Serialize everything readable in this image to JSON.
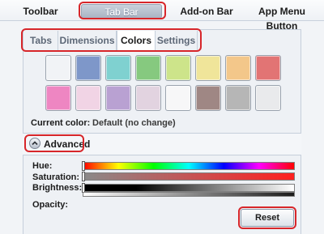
{
  "top_tabs": [
    {
      "label": "Toolbar"
    },
    {
      "label": "Tab Bar",
      "selected": true
    },
    {
      "label": "Add-on Bar"
    },
    {
      "label": "App Menu Button"
    }
  ],
  "sub_tabs": [
    {
      "label": "Tabs"
    },
    {
      "label": "Dimensions"
    },
    {
      "label": "Colors",
      "selected": true
    },
    {
      "label": "Settings"
    }
  ],
  "swatches": [
    {
      "color": "#f1f3f6"
    },
    {
      "color": "#7e97c9"
    },
    {
      "color": "#7fd1d0"
    },
    {
      "color": "#86c97f"
    },
    {
      "color": "#cde48a"
    },
    {
      "color": "#f0e59a"
    },
    {
      "color": "#f3c78a"
    },
    {
      "color": "#e27474"
    },
    {
      "color": "#ee86c2"
    },
    {
      "color": "#f1d4e5"
    },
    {
      "color": "#b9a1d2"
    },
    {
      "color": "#e2d3e0"
    },
    {
      "color": "#f7f7f8"
    },
    {
      "color": "#9f8784"
    },
    {
      "color": "#b6b6b6"
    },
    {
      "color": "#e9eaec"
    }
  ],
  "current_color": {
    "label": "Current color:",
    "value": "Default (no change)"
  },
  "advanced": {
    "label": "Advanced"
  },
  "sliders": [
    {
      "label": "Hue:"
    },
    {
      "label": "Saturation:"
    },
    {
      "label": "Brightness:"
    },
    {
      "label": "Opacity:"
    }
  ],
  "reset_label": "Reset",
  "accent_color": "#d7262a"
}
